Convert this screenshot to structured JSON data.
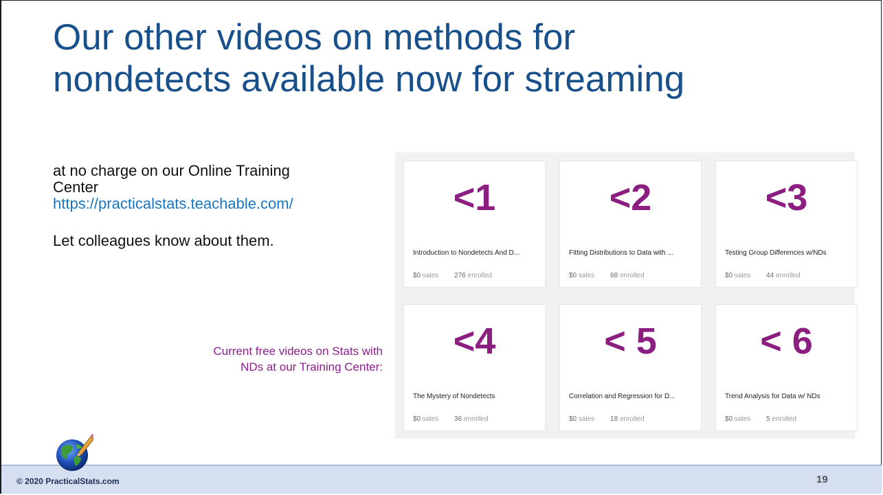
{
  "slide": {
    "title_line1": "Our other videos on methods for",
    "title_line2": "nondetects available now for streaming",
    "intro_line1": "at no charge on our Online Training",
    "intro_line2": "Center",
    "intro_link": "https://practicalstats.teachable.com/",
    "intro_tell": "Let colleagues know about them.",
    "caption_line1": "Current free videos on Stats with",
    "caption_line2": "NDs at our Training Center:",
    "footer_copyright": "© 2020 PracticalStats.com",
    "page_number": "19"
  },
  "courses": [
    {
      "thumb": "<1",
      "name": "Introduction to Nondetects And D...",
      "price": "$0",
      "price_label": "sales",
      "enrolled": "276",
      "enrolled_label": "enrolled"
    },
    {
      "thumb": "<2",
      "name": "Fitting Distributions to Data with ...",
      "price": "$0",
      "price_label": "sales",
      "enrolled": "68",
      "enrolled_label": "enrolled"
    },
    {
      "thumb": "<3",
      "name": "Testing Group Differences w/NDs",
      "price": "$0",
      "price_label": "sales",
      "enrolled": "44",
      "enrolled_label": "enrolled"
    },
    {
      "thumb": "<4",
      "name": "The Mystery of Nondetects",
      "price": "$0",
      "price_label": "sales",
      "enrolled": "36",
      "enrolled_label": "enrolled"
    },
    {
      "thumb": "< 5",
      "name": "Correlation and Regression for D...",
      "price": "$0",
      "price_label": "sales",
      "enrolled": "18",
      "enrolled_label": "enrolled"
    },
    {
      "thumb": "< 6",
      "name": "Trend Analysis for Data w/ NDs",
      "price": "$0",
      "price_label": "sales",
      "enrolled": "5",
      "enrolled_label": "enrolled"
    }
  ],
  "colors": {
    "title": "#17508a",
    "link": "#1976c2",
    "caption": "#8a1f8a",
    "thumb_text": "#8b1e80",
    "footer_bg": "#d6dff0"
  }
}
